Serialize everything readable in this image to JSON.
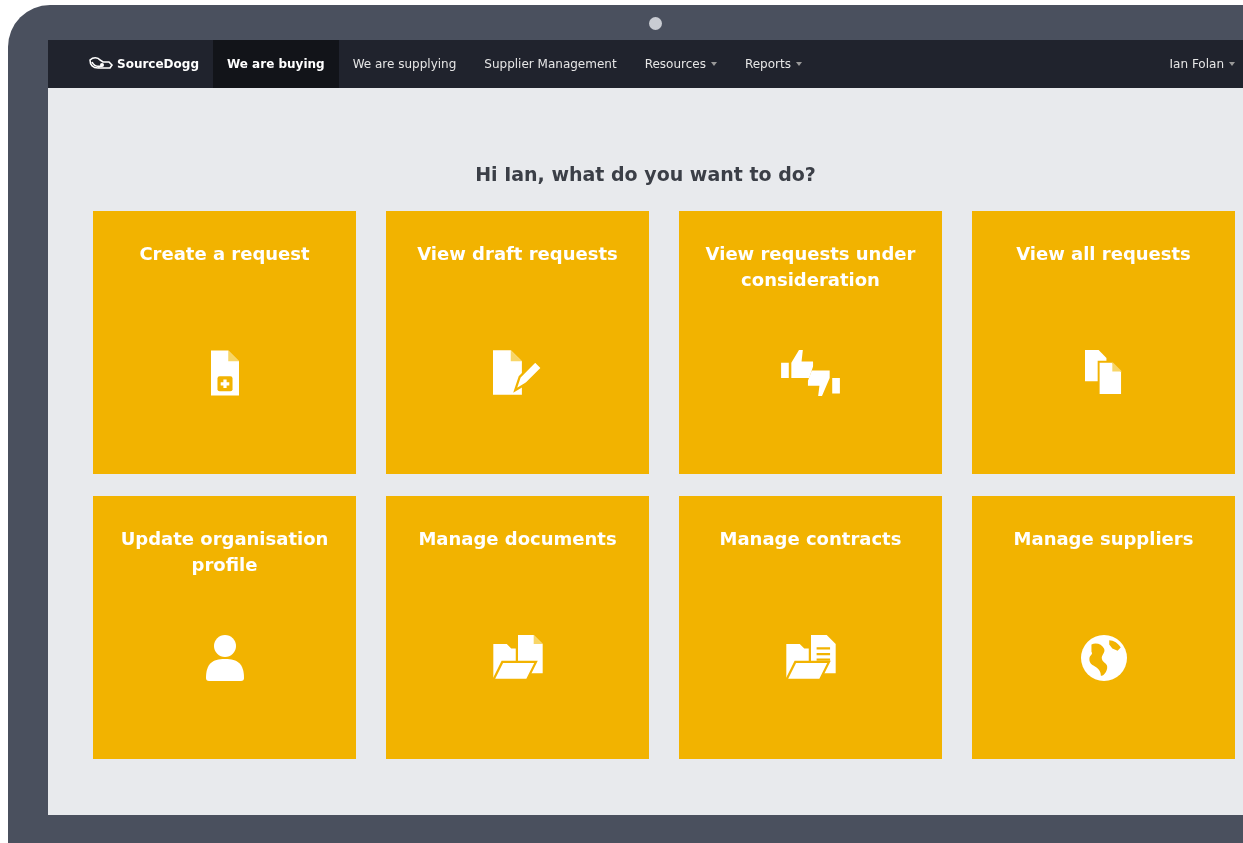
{
  "navbar": {
    "brand": "SourceDogg",
    "items": [
      {
        "label": "We are buying",
        "selected": true,
        "dropdown": false
      },
      {
        "label": "We are supplying",
        "selected": false,
        "dropdown": false
      },
      {
        "label": "Supplier Management",
        "selected": false,
        "dropdown": false
      },
      {
        "label": "Resources",
        "selected": false,
        "dropdown": true
      },
      {
        "label": "Reports",
        "selected": false,
        "dropdown": true
      }
    ],
    "user": {
      "label": "Ian Folan",
      "dropdown": true
    }
  },
  "heading": "Hi Ian, what do you want to do?",
  "tiles": [
    {
      "title": "Create a request"
    },
    {
      "title": "View draft requests"
    },
    {
      "title": "View requests under consideration"
    },
    {
      "title": "View all requests"
    },
    {
      "title": "Update organisation profile"
    },
    {
      "title": "Manage documents"
    },
    {
      "title": "Manage contracts"
    },
    {
      "title": "Manage suppliers"
    }
  ]
}
